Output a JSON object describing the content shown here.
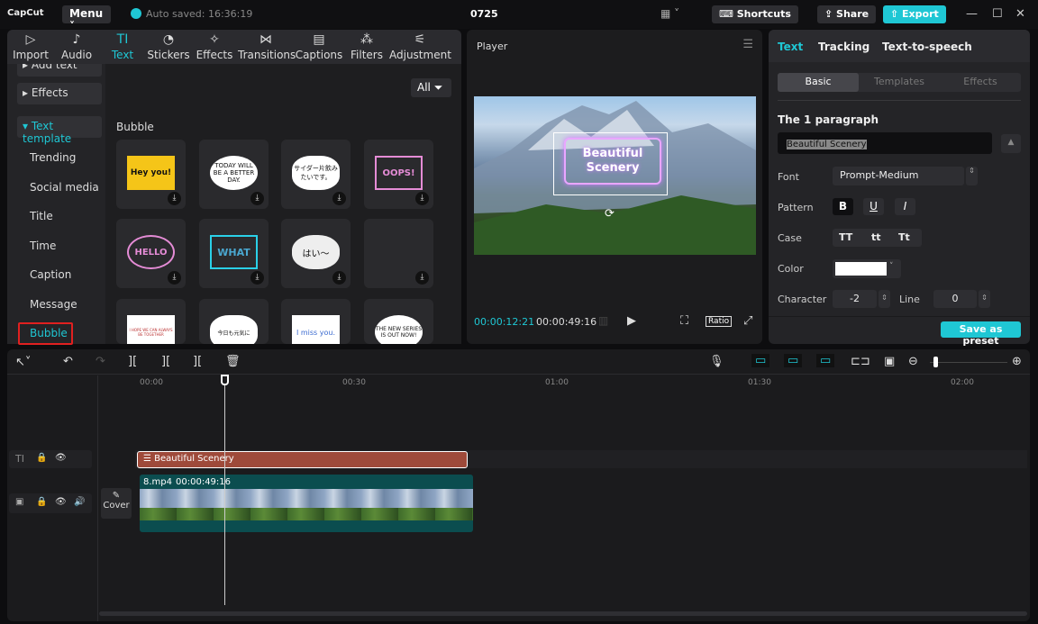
{
  "topbar": {
    "logo": "CapCut",
    "menu": "Menu",
    "autosave": "Auto saved: 16:36:19",
    "project_title": "0725",
    "shortcuts": "Shortcuts",
    "share": "Share",
    "export": "Export"
  },
  "media_tabs": [
    {
      "label": "Import",
      "icon": "▷"
    },
    {
      "label": "Audio",
      "icon": "♪"
    },
    {
      "label": "Text",
      "icon": "TI"
    },
    {
      "label": "Stickers",
      "icon": "◔"
    },
    {
      "label": "Effects",
      "icon": "✧"
    },
    {
      "label": "Transitions",
      "icon": "⋈"
    },
    {
      "label": "Captions",
      "icon": "▤"
    },
    {
      "label": "Filters",
      "icon": "⁂"
    },
    {
      "label": "Adjustment",
      "icon": "⚟"
    }
  ],
  "left_nav": {
    "add_text": "Add text",
    "effects": "Effects",
    "text_template": "Text template",
    "items": [
      "Trending",
      "Social media",
      "Title",
      "Time",
      "Caption",
      "Message",
      "Bubble"
    ]
  },
  "content": {
    "filter": "All",
    "section": "Bubble",
    "templates": [
      "Hey you!",
      "TODAY WILL BE A BETTER DAY.",
      "サイダー片飲みたいです。",
      "OOPS!",
      "HELLO",
      "WHAT",
      "はい〜",
      "",
      "I HOPE WE CAN ALWAYS BE TOGETHER",
      "今日も元気に",
      "I miss you.",
      "THE NEW SERIES IS OUT NOW!"
    ]
  },
  "player": {
    "title": "Player",
    "overlay_text": "Beautiful Scenery",
    "current_time": "00:00:12:21",
    "total_time": "00:00:49:16",
    "ratio": "Ratio"
  },
  "inspector": {
    "tabs": [
      "Text",
      "Tracking",
      "Text-to-speech"
    ],
    "subtabs": [
      "Basic",
      "Templates",
      "Effects"
    ],
    "paragraph": "The 1 paragraph",
    "text_value": "Beautiful Scenery",
    "font_label": "Font",
    "font_value": "Prompt-Medium",
    "pattern_label": "Pattern",
    "pattern": [
      "B",
      "U",
      "I"
    ],
    "case_label": "Case",
    "case": [
      "TT",
      "tt",
      "Tt"
    ],
    "color_label": "Color",
    "color_value": "#ffffff",
    "character_label": "Character",
    "character_value": "-2",
    "line_label": "Line",
    "line_value": "0",
    "save_preset": "Save as preset"
  },
  "timeline": {
    "ruler": [
      "00:00",
      "00:30",
      "01:00",
      "01:30",
      "02:00"
    ],
    "text_clip": "Beautiful Scenery",
    "video_clip_name": "8.mp4",
    "video_clip_duration": "00:00:49:16",
    "cover": "Cover",
    "zoom_level": 0.05
  },
  "colors": {
    "accent": "#1fc7d4",
    "text_clip": "#9e4a3a",
    "video_clip": "#0b4d4f",
    "selection": "#e02020"
  }
}
